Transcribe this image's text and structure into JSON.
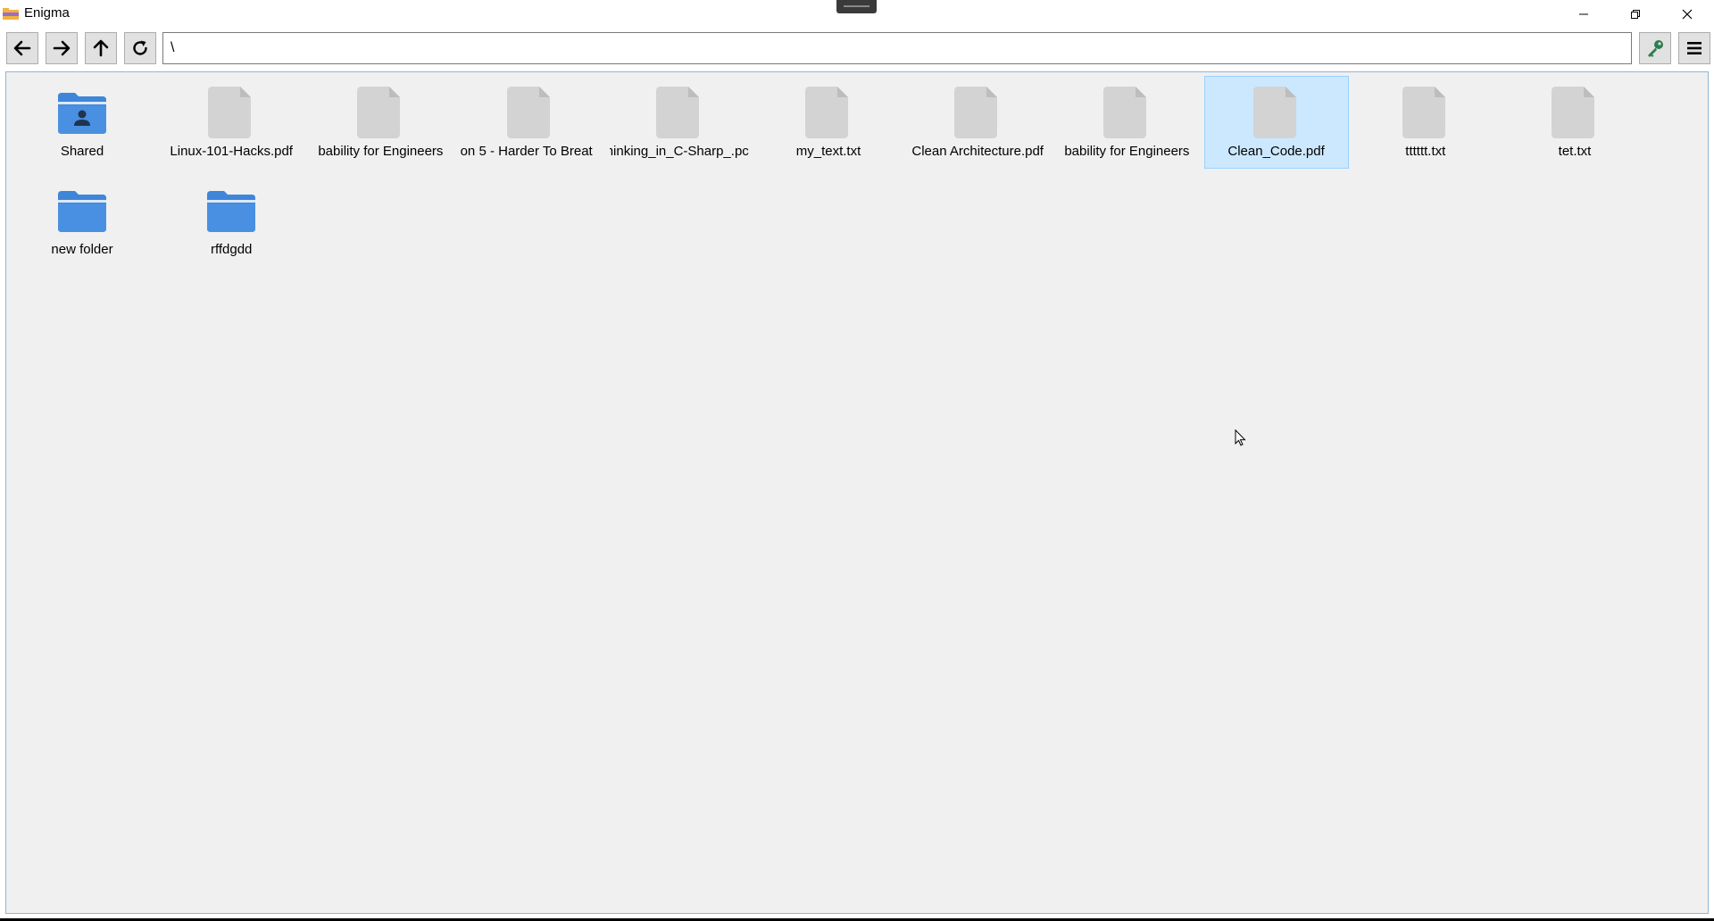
{
  "window": {
    "title": "Enigma",
    "icon": "app-folder-icon",
    "accent_color": "#cce8ff"
  },
  "toolbar": {
    "back_icon": "arrow-left-icon",
    "forward_icon": "arrow-right-icon",
    "up_icon": "arrow-up-icon",
    "refresh_icon": "refresh-icon",
    "path_value": "\\",
    "key_icon": "key-icon",
    "menu_icon": "hamburger-menu-icon"
  },
  "items": [
    {
      "name": "Shared",
      "type": "shared-folder",
      "selected": false
    },
    {
      "name": "Linux-101-Hacks.pdf",
      "type": "file",
      "selected": false
    },
    {
      "name": "bability for Engineers",
      "type": "file",
      "selected": false
    },
    {
      "name": "on 5 - Harder To Breat",
      "type": "file",
      "selected": false
    },
    {
      "name": "ninking_in_C-Sharp_.pc",
      "type": "file",
      "selected": false
    },
    {
      "name": "my_text.txt",
      "type": "file",
      "selected": false
    },
    {
      "name": "Clean Architecture.pdf",
      "type": "file",
      "selected": false
    },
    {
      "name": "bability for Engineers",
      "type": "file",
      "selected": false
    },
    {
      "name": "Clean_Code.pdf",
      "type": "file",
      "selected": true
    },
    {
      "name": "tttttt.txt",
      "type": "file",
      "selected": false
    },
    {
      "name": "tet.txt",
      "type": "file",
      "selected": false
    },
    {
      "name": "new folder",
      "type": "folder",
      "selected": false
    },
    {
      "name": "rffdgdd",
      "type": "folder",
      "selected": false
    }
  ]
}
